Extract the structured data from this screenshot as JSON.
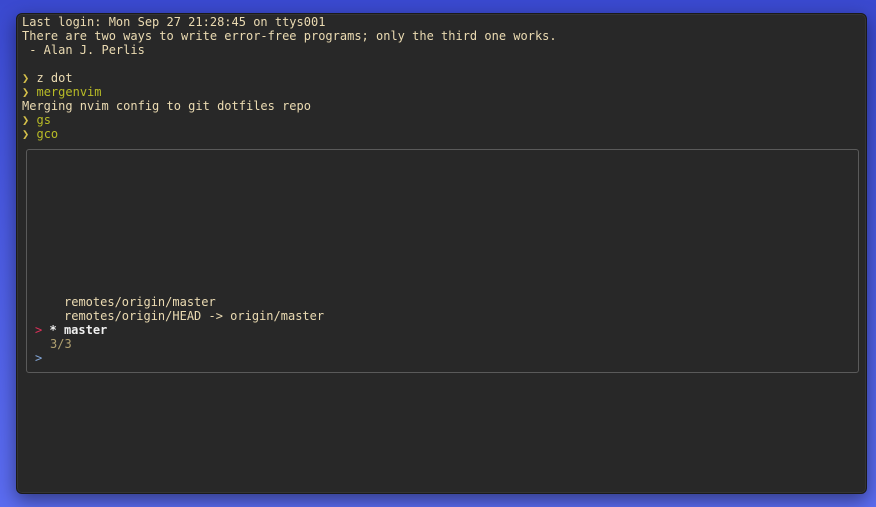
{
  "terminal": {
    "lines": [
      "Last login: Mon Sep 27 21:28:45 on ttys001",
      "There are two ways to write error-free programs; only the third one works.",
      " - Alan J. Perlis"
    ],
    "history": [
      {
        "prompt": "❯",
        "command": "z dot"
      },
      {
        "prompt": "❯",
        "command": "mergenvim"
      },
      {
        "output": "Merging nvim config to git dotfiles repo"
      },
      {
        "prompt": "❯",
        "command": "gs"
      },
      {
        "prompt": "❯",
        "command": "gco"
      }
    ]
  },
  "fzf": {
    "items": [
      "remotes/origin/master",
      "remotes/origin/HEAD -> origin/master"
    ],
    "selected": {
      "pointer": ">",
      "marker": "*",
      "label": "master"
    },
    "count": "3/3",
    "query_prompt": ">"
  }
}
